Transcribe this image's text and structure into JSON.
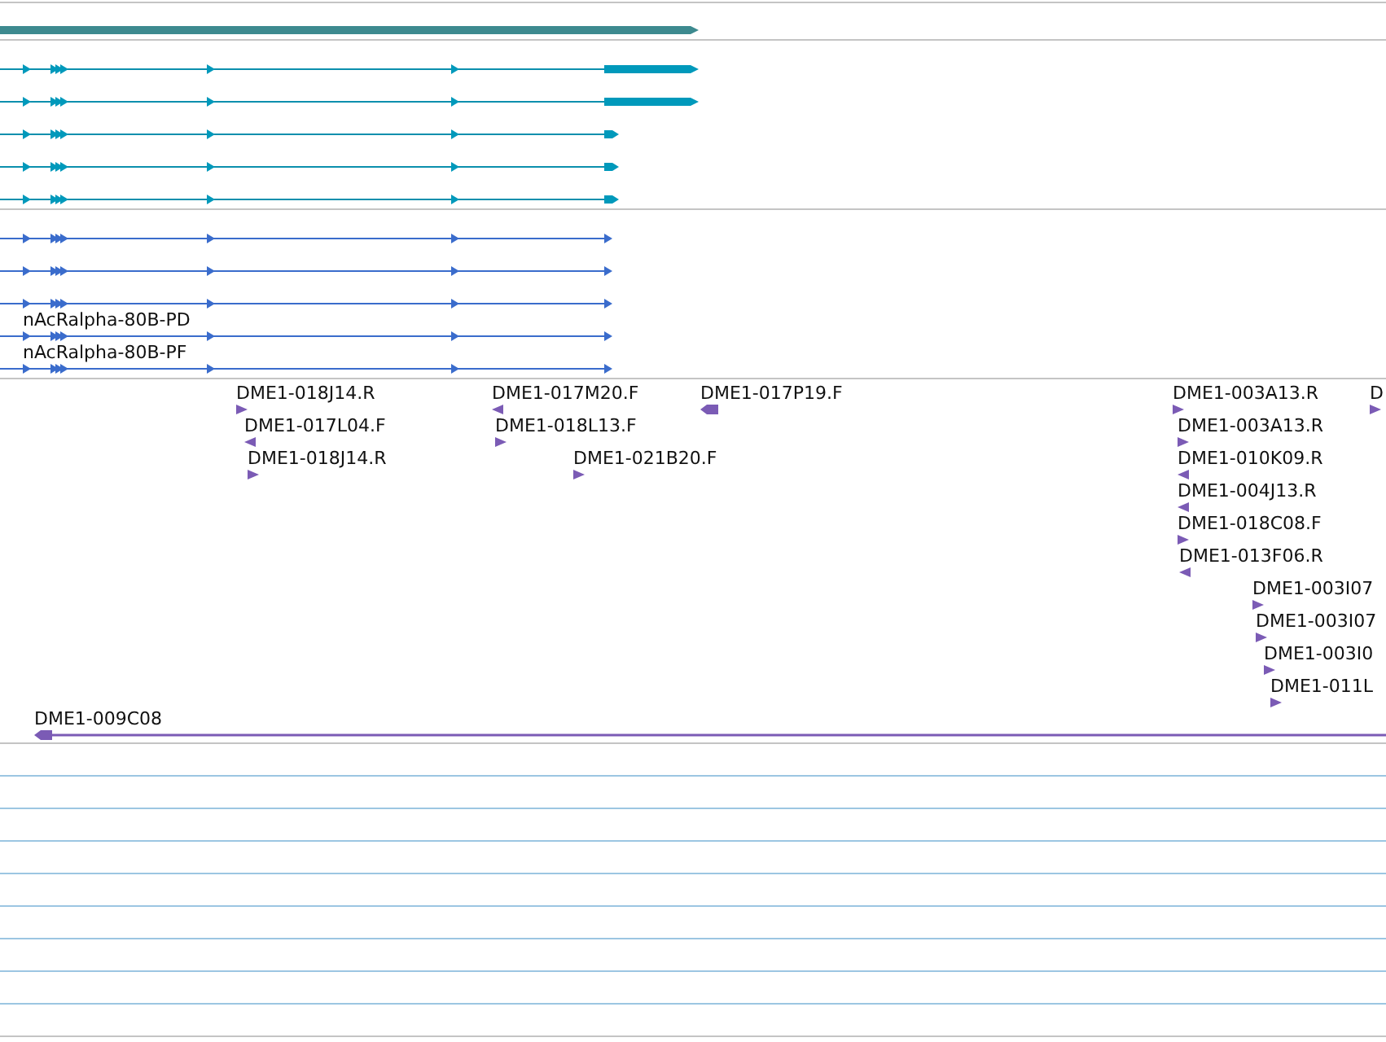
{
  "gene_track": {
    "features": [
      {
        "kind": "gene"
      }
    ]
  },
  "transcript_track_1": {
    "rows": [
      {
        "kind": "long-tail"
      },
      {
        "kind": "long-tail"
      },
      {
        "kind": "short-tail"
      },
      {
        "kind": "short-tail"
      },
      {
        "kind": "short-tail"
      }
    ]
  },
  "transcript_track_2": {
    "rows": [
      {
        "kind": "plain"
      },
      {
        "kind": "plain"
      },
      {
        "kind": "plain"
      },
      {
        "kind": "labeled",
        "label": "nAcRalpha-80B-PD"
      },
      {
        "kind": "labeled",
        "label": "nAcRalpha-80B-PF"
      }
    ]
  },
  "est_track": {
    "features": [
      {
        "label": "DME1-018J14.R",
        "reverse": false
      },
      {
        "label": "DME1-017L04.F",
        "reverse": true
      },
      {
        "label": "DME1-018J14.R",
        "reverse": false
      },
      {
        "label": "DME1-017M20.F",
        "reverse": true
      },
      {
        "label": "DME1-018L13.F",
        "reverse": false
      },
      {
        "label": "DME1-021B20.F",
        "reverse": false
      },
      {
        "label": "DME1-017P19.F",
        "reverse": true
      },
      {
        "label": "DME1-003A13.R",
        "reverse": false
      },
      {
        "label": "D",
        "reverse": false
      },
      {
        "label": "DME1-003A13.R",
        "reverse": false
      },
      {
        "label": "DME1-010K09.R",
        "reverse": true
      },
      {
        "label": "DME1-004J13.R",
        "reverse": true
      },
      {
        "label": "DME1-018C08.F",
        "reverse": false
      },
      {
        "label": "DME1-013F06.R",
        "reverse": true
      },
      {
        "label": "DME1-003I07",
        "reverse": false
      },
      {
        "label": "DME1-003I07",
        "reverse": false
      },
      {
        "label": "DME1-003I0",
        "reverse": false
      },
      {
        "label": "DME1-011L",
        "reverse": false
      },
      {
        "label": "DME1-009C08",
        "reverse": true
      }
    ]
  }
}
